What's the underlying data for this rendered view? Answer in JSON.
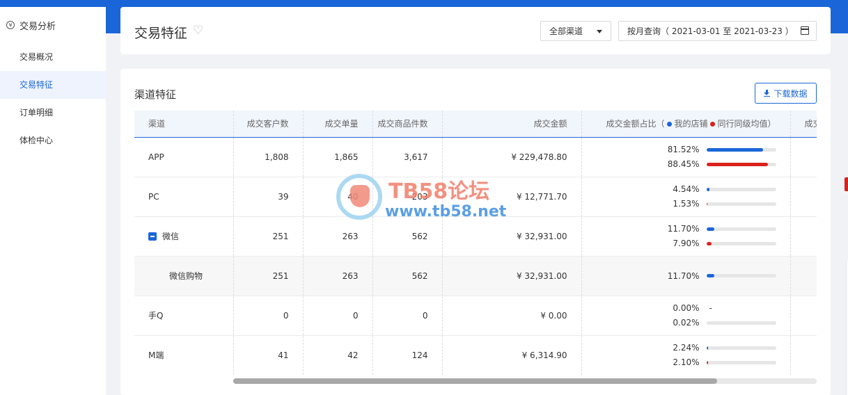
{
  "sidebar": {
    "head": "交易分析",
    "items": [
      {
        "label": "交易概况"
      },
      {
        "label": "交易特征",
        "active": true
      },
      {
        "label": "订单明细"
      },
      {
        "label": "体检中心"
      }
    ]
  },
  "header": {
    "title": "交易特征",
    "channel_select": "全部渠道",
    "date_select": "按月查询（ 2021-03-01 至 2021-03-23 ）"
  },
  "section": {
    "title": "渠道特征",
    "download_label": "下载数据"
  },
  "table": {
    "columns": [
      "渠道",
      "成交客户数",
      "成交单量",
      "成交商品件数",
      "成交金额",
      "成交金额占比（",
      "成交"
    ],
    "legend": {
      "mine": "我的店铺",
      "peer": "同行同级均值",
      "close": "）"
    },
    "rows": [
      {
        "name": "APP",
        "customers": "1,808",
        "orders": "1,865",
        "items": "3,617",
        "amount": "¥ 229,478.80",
        "mine_pct": "81.52%",
        "mine_value": 81.52,
        "peer_pct": "88.45%",
        "peer_value": 88.45
      },
      {
        "name": "PC",
        "customers": "39",
        "orders": "40",
        "items": "203",
        "amount": "¥ 12,771.70",
        "mine_pct": "4.54%",
        "mine_value": 4.54,
        "peer_pct": "1.53%",
        "peer_value": 1.53
      },
      {
        "name": "微信",
        "customers": "251",
        "orders": "263",
        "items": "562",
        "amount": "¥ 32,931.00",
        "mine_pct": "11.70%",
        "mine_value": 11.7,
        "peer_pct": "7.90%",
        "peer_value": 7.9
      },
      {
        "name": "微信购物",
        "customers": "251",
        "orders": "263",
        "items": "562",
        "amount": "¥ 32,931.00",
        "mine_pct": "11.70%",
        "mine_value": 11.7
      },
      {
        "name": "手Q",
        "customers": "0",
        "orders": "0",
        "items": "0",
        "amount": "¥ 0.00",
        "mine_pct": "0.00%",
        "mine_dash": "-",
        "peer_pct": "0.02%",
        "peer_value": 0.02
      },
      {
        "name": "M端",
        "customers": "41",
        "orders": "42",
        "items": "124",
        "amount": "¥ 6,314.90",
        "mine_pct": "2.24%",
        "mine_value": 2.24,
        "peer_pct": "2.10%",
        "peer_value": 2.1
      }
    ]
  },
  "watermark": {
    "line1": "TB58论坛",
    "line2": "www.tb58.net"
  },
  "colors": {
    "brand": "#1a66d9",
    "mine": "#1a66d9",
    "peer": "#d9211d"
  }
}
